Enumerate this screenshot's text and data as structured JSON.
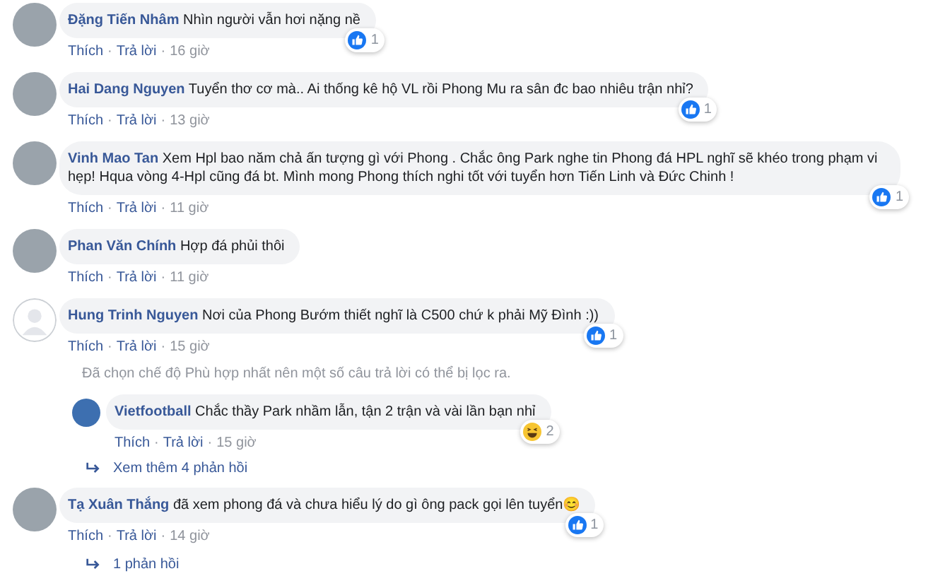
{
  "comments": [
    {
      "author": "Đặng Tiến Nhâm",
      "default_avatar": false,
      "text": "Nhìn người vẫn hơi nặng nề",
      "actions": [
        "Thích",
        "·",
        "Trả lời",
        "·"
      ],
      "time": "16 giờ",
      "reaction": {
        "kind": "like",
        "count": "1"
      }
    },
    {
      "author": "Hai Dang Nguyen",
      "default_avatar": false,
      "text": "Tuyển thơ cơ mà.. Ai thống kê hộ VL rồi Phong Mu ra sân đc bao nhiêu trận nhỉ?",
      "actions": [
        "Thích",
        "·",
        "Trả lời",
        "·"
      ],
      "time": "13 giờ",
      "reaction": {
        "kind": "like",
        "count": "1"
      }
    },
    {
      "author": "Vinh Mao Tan",
      "default_avatar": false,
      "text": "Xem Hpl bao năm chả ấn tượng gì với Phong . Chắc ông Park nghe tin Phong đá HPL nghĩ sẽ khéo trong phạm vi hẹp! Hqua vòng 4-Hpl cũng đá bt. Mình mong Phong thích nghi tốt với tuyển hơn Tiến Linh và Đức Chinh !",
      "actions": [
        "Thích",
        "·",
        "Trả lời",
        "·"
      ],
      "time": "11 giờ",
      "reaction": {
        "kind": "like",
        "count": "1"
      }
    },
    {
      "author": "Phan Văn Chính",
      "default_avatar": false,
      "text": "Hợp đá phủi thôi",
      "actions": [
        "Thích",
        "·",
        "Trả lời",
        "·"
      ],
      "time": "11 giờ"
    },
    {
      "author": "Hung Trinh Nguyen",
      "default_avatar": true,
      "text": "Nơi của Phong Bướm thiết nghĩ là C500 chứ k phải Mỹ Đình :))",
      "actions": [
        "Thích",
        "·",
        "Trả lời",
        "·"
      ],
      "time": "15 giờ",
      "reaction": {
        "kind": "like",
        "count": "1"
      },
      "notice": "Đã chọn chế độ Phù hợp nhất nên một số câu trả lời có thể bị lọc ra.",
      "replies": [
        {
          "author": "Vietfootball",
          "default_avatar": false,
          "text": "Chắc thầy Park nhầm lẫn, tận 2 trận và vài lần bạn nhỉ",
          "actions": [
            "Thích",
            "·",
            "Trả lời",
            "·"
          ],
          "time": "15 giờ",
          "reaction": {
            "kind": "haha",
            "count": "2"
          }
        }
      ],
      "more_replies": "Xem thêm 4 phản hồi"
    },
    {
      "author": "Tạ Xuân Thắng",
      "default_avatar": false,
      "text": "đã xem phong đá và chưa hiểu lý do gì ông pack gọi lên tuyển😊",
      "actions": [
        "Thích",
        "·",
        "Trả lời",
        "·"
      ],
      "time": "14 giờ",
      "reaction": {
        "kind": "like",
        "count": "1"
      },
      "more_replies": "1 phản hồi"
    }
  ]
}
